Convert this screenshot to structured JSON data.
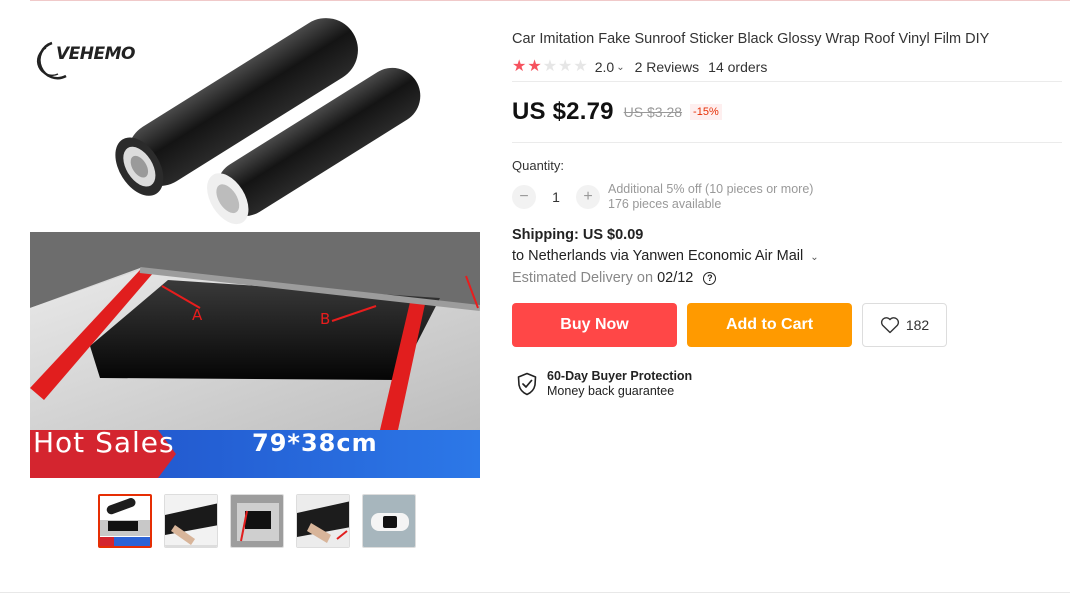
{
  "product": {
    "title": "Car Imitation Fake Sunroof Sticker Black Glossy Wrap Roof Vinyl Film DIY",
    "rating": {
      "score": "2.0",
      "stars_filled": 2,
      "stars_total": 5,
      "reviews": "2 Reviews",
      "orders": "14 orders"
    },
    "price": {
      "current": "US $2.79",
      "original": "US $3.28",
      "discount": "-15%"
    }
  },
  "gallery": {
    "brand_logo": "VEHEMO",
    "banner_left": "Hot Sales",
    "banner_right": "79*38cm",
    "arrow_label_a": "A",
    "arrow_label_b": "B",
    "thumbnail_count": 5,
    "active_thumbnail": 0
  },
  "quantity": {
    "label": "Quantity:",
    "value": "1",
    "minus_icon": "−",
    "plus_icon": "+",
    "note_line1": "Additional 5% off (10 pieces or more)",
    "note_line2": "176 pieces available"
  },
  "shipping": {
    "label": "Shipping: US $0.09",
    "destination": "to Netherlands via Yanwen Economic Air Mail",
    "delivery_label": "Estimated Delivery on",
    "delivery_date": "02/12",
    "help_icon": "?"
  },
  "actions": {
    "buy_now": "Buy Now",
    "add_to_cart": "Add to Cart",
    "wishlist_count": "182"
  },
  "protection": {
    "title": "60-Day Buyer Protection",
    "subtitle": "Money back guarantee"
  },
  "colors": {
    "buy_now": "#ff4747",
    "add_to_cart": "#ff9a00",
    "star_on": "#f6525e",
    "discount": "#e62e04"
  }
}
